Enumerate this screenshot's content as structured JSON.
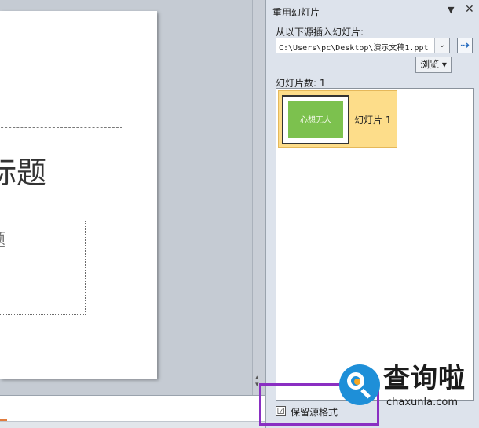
{
  "pane": {
    "title": "重用幻灯片",
    "menu_icon": "▼",
    "close_icon": "✕",
    "source_label": "从以下源插入幻灯片:",
    "source_path": "C:\\Users\\pc\\Desktop\\演示文稿1.ppt",
    "dropdown_icon": "⌄",
    "go_icon": "⇢",
    "browse_label": "浏览 ▾",
    "slide_count_label": "幻灯片数: 1",
    "slides": [
      {
        "thumb_text": "心想无人",
        "label": "幻灯片 1"
      }
    ],
    "keep_format_checked": "☑",
    "keep_format_label": "保留源格式"
  },
  "slide": {
    "title_text": "标题",
    "subtitle_text": "题"
  },
  "watermark": {
    "name": "查询啦",
    "url": "chaxunla.com"
  },
  "colors": {
    "highlight": "#8a2fc2",
    "selected_item": "#fddd8a",
    "thumb_green": "#7cc14e",
    "logo_blue": "#1e8fd8"
  }
}
